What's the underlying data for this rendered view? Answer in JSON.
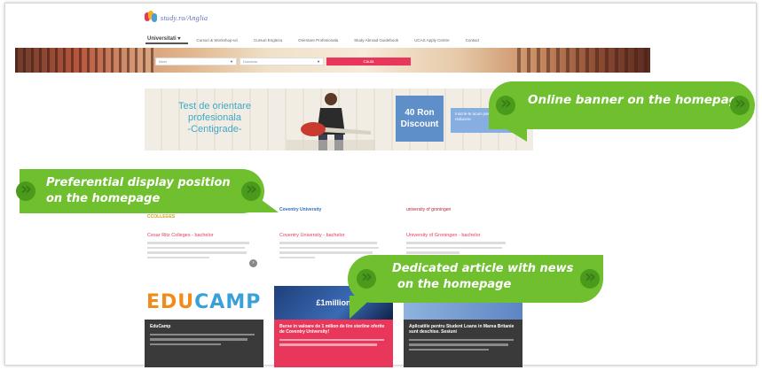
{
  "logo": {
    "text": "study.ro/Anglia"
  },
  "nav": {
    "items": [
      {
        "label": "Universitati ▾",
        "active": true
      },
      {
        "label": "Cursuri & Workshop-uri"
      },
      {
        "label": "Cursuri Engleza"
      },
      {
        "label": "Orientare Profesionala"
      },
      {
        "label": "Study Abroad Guidebook"
      },
      {
        "label": "UCAS Apply Centre"
      },
      {
        "label": "Contact"
      }
    ]
  },
  "search": {
    "field1": "Nivel",
    "field2": "Domeniu",
    "button": "Cauta"
  },
  "banner": {
    "line1": "Test de orientare",
    "line2": "profesionala",
    "line3": "-Centigrade-",
    "price_line1": "40 Ron",
    "price_line2": "Discount",
    "cta": "Inscrie-te acum pentru a beneficia de reducere"
  },
  "callouts": {
    "banner": "Online banner on the homepage",
    "preferential_line1": "Preferential display position",
    "preferential_line2": "on the homepage",
    "article_line1": "Dedicated article with news",
    "article_line2": "on the homepage"
  },
  "cards": [
    {
      "logo": "CCOLLEGES",
      "title": "Cesar Ritz Colleges - bachelor"
    },
    {
      "logo": "Coventry University",
      "title": "Coventry University - bachelor"
    },
    {
      "logo": "university of groningen",
      "title": "University of Groningen - bachelor"
    }
  ],
  "tiles": [
    {
      "title": "EduCamp",
      "brand1": "EDU",
      "brand2": "CAMP"
    },
    {
      "hero": "£1million",
      "title": "Burse in valoare de 1 milion de lire sterline oferite de Coventry University!"
    },
    {
      "hero": "Student Loan in Marea Britanie",
      "title": "Aplicatiile pentru Student Loans in Marea Britanie sunt deschise. Sesiuni"
    }
  ],
  "colors": {
    "accent": "#e8375a",
    "callout": "#6fbf2e",
    "banner_blue": "#5f8fc9"
  }
}
